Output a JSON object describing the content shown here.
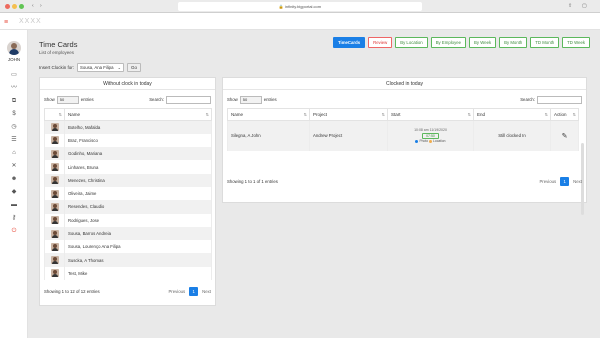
{
  "browser": {
    "url": "infinity.bigportal.com",
    "back": "‹",
    "forward": "›"
  },
  "header": {
    "brand": "XXXX",
    "menu_icon": "hamburger-icon"
  },
  "sidebar": {
    "user_name": "JOHN",
    "icons": [
      "monitor-icon",
      "chart-icon",
      "hierarchy-icon",
      "dollar-icon",
      "clock-icon",
      "list-icon",
      "bank-icon",
      "tools-icon",
      "user-plus-icon",
      "tag-icon",
      "folder-icon",
      "key-icon",
      "power-icon"
    ]
  },
  "page": {
    "title": "Time Cards",
    "subtitle": "List of employees"
  },
  "tabs": [
    {
      "label": "TimeCards",
      "state": "active"
    },
    {
      "label": "Review",
      "state": "red"
    },
    {
      "label": "By Location",
      "state": "normal"
    },
    {
      "label": "By Employee",
      "state": "normal"
    },
    {
      "label": "By Week",
      "state": "normal"
    },
    {
      "label": "By Month",
      "state": "normal"
    },
    {
      "label": "TD Month",
      "state": "normal"
    },
    {
      "label": "TD Week",
      "state": "normal"
    }
  ],
  "insert": {
    "label": "Insert Clockin for:",
    "selected": "Sousa, Ana Filipa",
    "go_label": "Go"
  },
  "left_panel": {
    "title": "Without clock in today",
    "show_label": "Show",
    "show_value": "50",
    "entries_label": "entries",
    "search_label": "Search:",
    "col_name": "Name",
    "rows": [
      "Botelho, Mafalda",
      "Braz, Francisco",
      "Godinho, Mariana",
      "Linhares, Bruna",
      "Menezes, Christina",
      "Oliveira, Jaime",
      "Resendes, Claudio",
      "Rodrigues, Jose",
      "Sousa, Barros Andreia",
      "Sousa, Lourenço Ana Filipa",
      "Suscka, A Thomas",
      "Test, Mike"
    ],
    "info": "Showing 1 to 12 of 12 entries",
    "prev": "Previous",
    "page": "1",
    "next": "Next"
  },
  "right_panel": {
    "title": "Clocked in today",
    "show_label": "Show",
    "show_value": "50",
    "entries_label": "entries",
    "search_label": "Search:",
    "cols": {
      "name": "Name",
      "project": "Project",
      "start": "Start",
      "end": "End",
      "action": "Action"
    },
    "row": {
      "name": "Silegna, A John",
      "project": "Andrew Project",
      "start_time": "10:08 am 11/19/2020",
      "start_chip": "07:50",
      "legend_a": "Photo",
      "legend_b": "Location",
      "end": "Still clocked In"
    },
    "info": "Showing 1 to 1 of 1 entries",
    "prev": "Previous",
    "page": "1",
    "next": "Next"
  },
  "colors": {
    "accent": "#1a7fe6",
    "tab_green": "#5cb85c",
    "tab_red": "#dd3333"
  }
}
